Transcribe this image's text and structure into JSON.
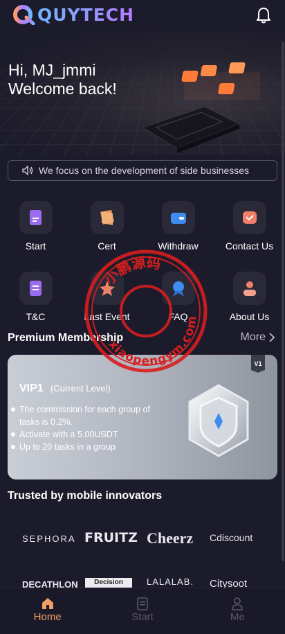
{
  "header": {
    "brand": "QUYTECH",
    "bell_icon": "bell-icon"
  },
  "hero": {
    "greeting": "Hi, MJ_jmmi",
    "welcome": "Welcome back!"
  },
  "notice": {
    "text": "We focus on the development of side businesses",
    "icon": "speaker-icon"
  },
  "quick_actions": [
    {
      "label": "Start",
      "icon": "document-icon",
      "color": "#9b6cf0"
    },
    {
      "label": "Cert",
      "icon": "certificate-icon",
      "color": "#f19a5a"
    },
    {
      "label": "Withdraw",
      "icon": "wallet-icon",
      "color": "#3f8cf0"
    },
    {
      "label": "Contact Us",
      "icon": "contact-icon",
      "color": "#f07f6a"
    },
    {
      "label": "T&C",
      "icon": "terms-icon",
      "color": "#9b6cf0"
    },
    {
      "label": "Last Event",
      "icon": "star-icon",
      "color": "#f07f6a"
    },
    {
      "label": "FAQ",
      "icon": "faq-icon",
      "color": "#3f8cf0"
    },
    {
      "label": "About Us",
      "icon": "about-icon",
      "color": "#f07f6a"
    }
  ],
  "membership": {
    "title": "Premium Membership",
    "more": "More",
    "card": {
      "tag": "V1",
      "name": "VIP1",
      "level": "(Current Level)",
      "benefits": [
        "The commission for each group of tasks is 0.2%.",
        "Activate with a 5.00USDT",
        "Up to 20 tasks in a group"
      ]
    }
  },
  "trusted": {
    "title": "Trusted by mobile innovators",
    "brands": [
      "SEPHORA",
      "FRUITZ",
      "Cheerz",
      "Cdiscount",
      "DECATHLON",
      "Decision",
      "LALALAB.",
      "Citysoot"
    ]
  },
  "watermark": {
    "top": "小鹏源码",
    "bottom": "xiaopengym.com"
  },
  "tabbar": {
    "items": [
      "Home",
      "Start",
      "Me"
    ],
    "active": "Home"
  },
  "colors": {
    "accent": "#ef9f65",
    "background": "#1c1b2b"
  }
}
